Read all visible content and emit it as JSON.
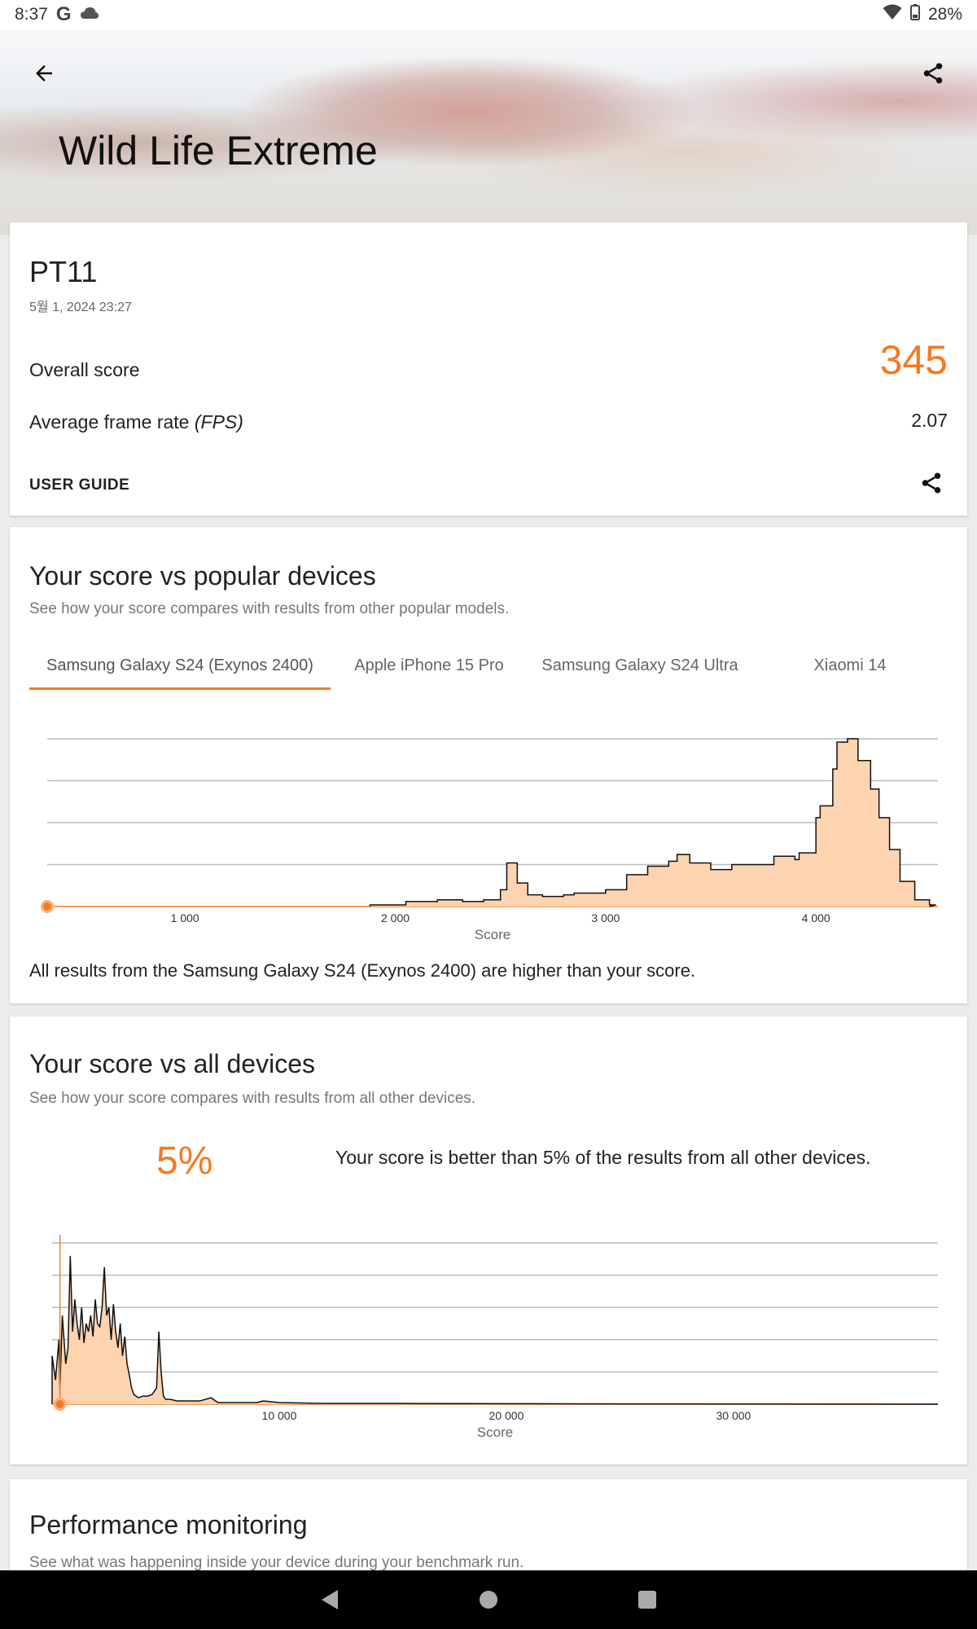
{
  "status_bar": {
    "time": "8:37",
    "battery": "28%"
  },
  "header": {
    "title": "Wild Life Extreme"
  },
  "result": {
    "device": "PT11",
    "date": "5월 1, 2024 23:27",
    "overall_label": "Overall score",
    "overall_value": "345",
    "fps_label": "Average frame rate",
    "fps_unit": "(FPS)",
    "fps_value": "2.07",
    "user_guide": "USER GUIDE"
  },
  "popular": {
    "title": "Your score vs popular devices",
    "subtitle": "See how your score compares with results from other popular models.",
    "tabs": [
      "Samsung Galaxy S24 (Exynos 2400)",
      "Apple iPhone 15 Pro",
      "Samsung Galaxy S24 Ultra",
      "Xiaomi 14"
    ],
    "active_tab": 0,
    "caption": "All results from the Samsung Galaxy S24 (Exynos 2400) are higher than your score."
  },
  "all_devices": {
    "title": "Your score vs all devices",
    "subtitle": "See how your score compares with results from all other devices.",
    "percent": "5%",
    "percent_text": "Your score is better than 5% of the results from all other devices."
  },
  "performance": {
    "title": "Performance monitoring",
    "subtitle": "See what was happening inside your device during your benchmark run."
  },
  "colors": {
    "accent": "#f47a20",
    "fill": "#fdd3b0"
  },
  "chart_data": [
    {
      "type": "area",
      "xlabel": "Score",
      "xticks": [
        "1 000",
        "2 000",
        "3 000",
        "4 000"
      ],
      "xlim": [
        345,
        4580
      ],
      "your_score": 345,
      "x": [
        1880,
        2050,
        2200,
        2320,
        2420,
        2500,
        2530,
        2580,
        2630,
        2700,
        2800,
        2850,
        2900,
        3000,
        3100,
        3200,
        3300,
        3340,
        3400,
        3500,
        3600,
        3700,
        3800,
        3900,
        3920,
        4000,
        4020,
        4080,
        4100,
        4150,
        4200,
        4260,
        4300,
        4350,
        4400,
        4470,
        4540
      ],
      "values": [
        0.01,
        0.03,
        0.04,
        0.03,
        0.04,
        0.1,
        0.26,
        0.14,
        0.07,
        0.06,
        0.07,
        0.08,
        0.08,
        0.1,
        0.19,
        0.24,
        0.27,
        0.31,
        0.26,
        0.22,
        0.25,
        0.25,
        0.3,
        0.28,
        0.32,
        0.53,
        0.6,
        0.82,
        0.98,
        1.0,
        0.87,
        0.7,
        0.53,
        0.34,
        0.15,
        0.04,
        0.01
      ]
    },
    {
      "type": "area",
      "xlabel": "Score",
      "xticks": [
        "10 000",
        "20 000",
        "30 000"
      ],
      "xlim": [
        0,
        39000
      ],
      "your_score": 345,
      "x": [
        0,
        150,
        300,
        345,
        450,
        600,
        700,
        800,
        900,
        1000,
        1100,
        1200,
        1300,
        1400,
        1500,
        1600,
        1700,
        1800,
        1900,
        2000,
        2100,
        2200,
        2300,
        2400,
        2500,
        2600,
        2700,
        2800,
        2900,
        3000,
        3100,
        3200,
        3300,
        3400,
        3500,
        3600,
        3700,
        3800,
        4000,
        4200,
        4400,
        4600,
        4700,
        4800,
        4900,
        5000,
        5200,
        5500,
        6000,
        6500,
        7000,
        7300,
        8000,
        9000,
        9300,
        10000,
        12000,
        15000,
        20000,
        25000,
        30000,
        39000
      ],
      "values": [
        0.3,
        0.15,
        0.4,
        0.1,
        0.55,
        0.25,
        0.35,
        0.92,
        0.45,
        0.65,
        0.5,
        0.4,
        0.6,
        0.38,
        0.5,
        0.45,
        0.55,
        0.42,
        0.65,
        0.5,
        0.48,
        0.6,
        0.85,
        0.55,
        0.6,
        0.4,
        0.62,
        0.45,
        0.35,
        0.5,
        0.3,
        0.42,
        0.25,
        0.18,
        0.1,
        0.06,
        0.05,
        0.04,
        0.05,
        0.05,
        0.06,
        0.1,
        0.45,
        0.2,
        0.05,
        0.03,
        0.03,
        0.02,
        0.02,
        0.02,
        0.04,
        0.01,
        0.01,
        0.01,
        0.02,
        0.01,
        0.005,
        0.005,
        0.003,
        0.002,
        0.001,
        0.0
      ]
    }
  ]
}
